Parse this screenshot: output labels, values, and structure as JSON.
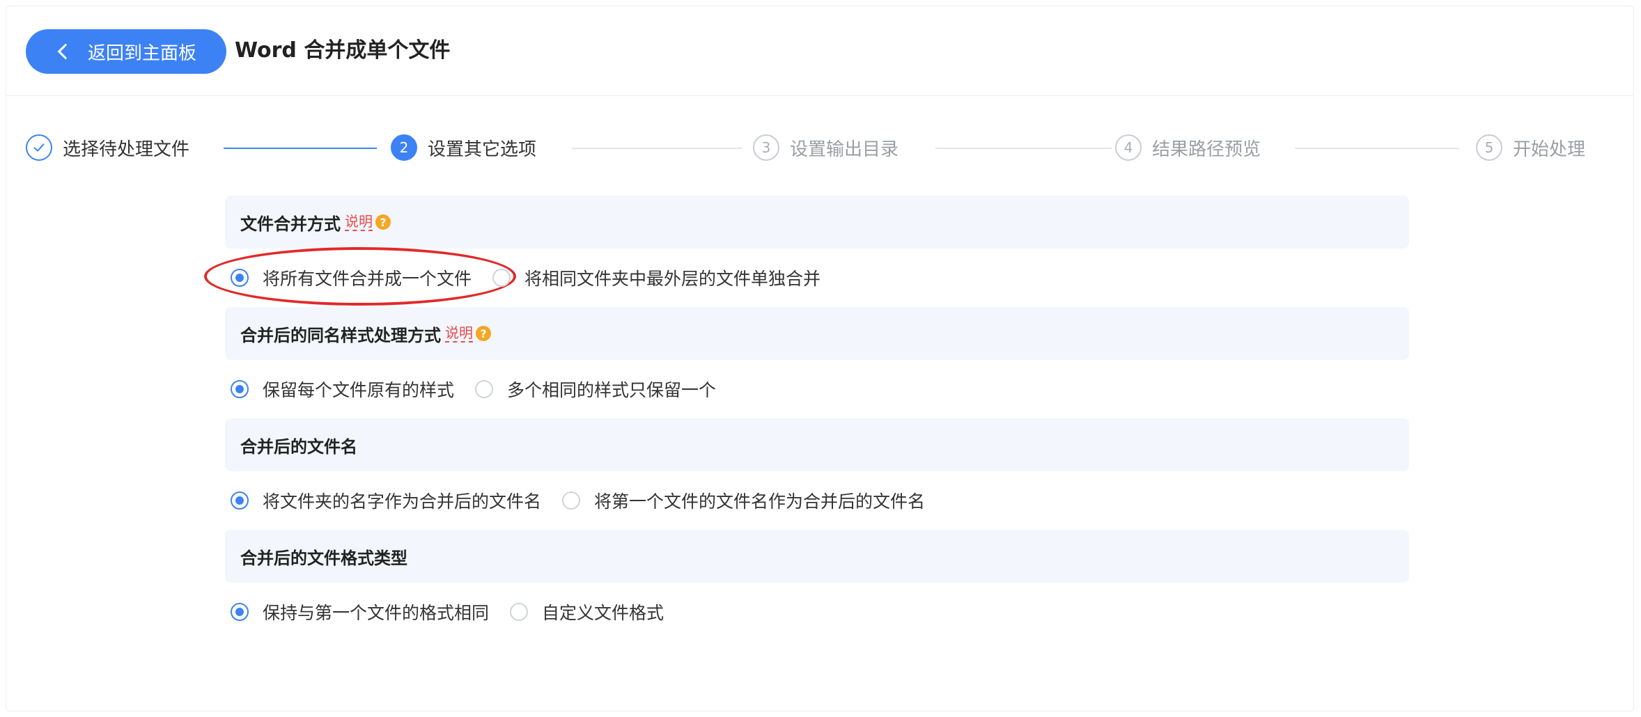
{
  "header": {
    "back_label": "返回到主面板",
    "title": "Word 合并成单个文件"
  },
  "steps": [
    {
      "number": "1",
      "label": "选择待处理文件",
      "state": "done"
    },
    {
      "number": "2",
      "label": "设置其它选项",
      "state": "active"
    },
    {
      "number": "3",
      "label": "设置输出目录",
      "state": "todo"
    },
    {
      "number": "4",
      "label": "结果路径预览",
      "state": "todo"
    },
    {
      "number": "5",
      "label": "开始处理",
      "state": "todo"
    }
  ],
  "sections": [
    {
      "title": "文件合并方式",
      "help_label": "说明",
      "options": [
        {
          "label": "将所有文件合并成一个文件",
          "checked": true
        },
        {
          "label": "将相同文件夹中最外层的文件单独合并",
          "checked": false
        }
      ]
    },
    {
      "title": "合并后的同名样式处理方式",
      "help_label": "说明",
      "options": [
        {
          "label": "保留每个文件原有的样式",
          "checked": true
        },
        {
          "label": "多个相同的样式只保留一个",
          "checked": false
        }
      ]
    },
    {
      "title": "合并后的文件名",
      "options": [
        {
          "label": "将文件夹的名字作为合并后的文件名",
          "checked": true
        },
        {
          "label": "将第一个文件的文件名作为合并后的文件名",
          "checked": false
        }
      ]
    },
    {
      "title": "合并后的文件格式类型",
      "options": [
        {
          "label": "保持与第一个文件的格式相同",
          "checked": true
        },
        {
          "label": "自定义文件格式",
          "checked": false
        }
      ]
    }
  ],
  "colors": {
    "accent": "#3d82f5",
    "help_link": "#e64b4b",
    "help_icon": "#f5a623",
    "section_bg": "#f3f6fc",
    "highlight_ring": "#e02a2a"
  },
  "icons": {
    "back": "chevron-left-icon",
    "step_done": "check-icon",
    "help": "question-icon"
  }
}
